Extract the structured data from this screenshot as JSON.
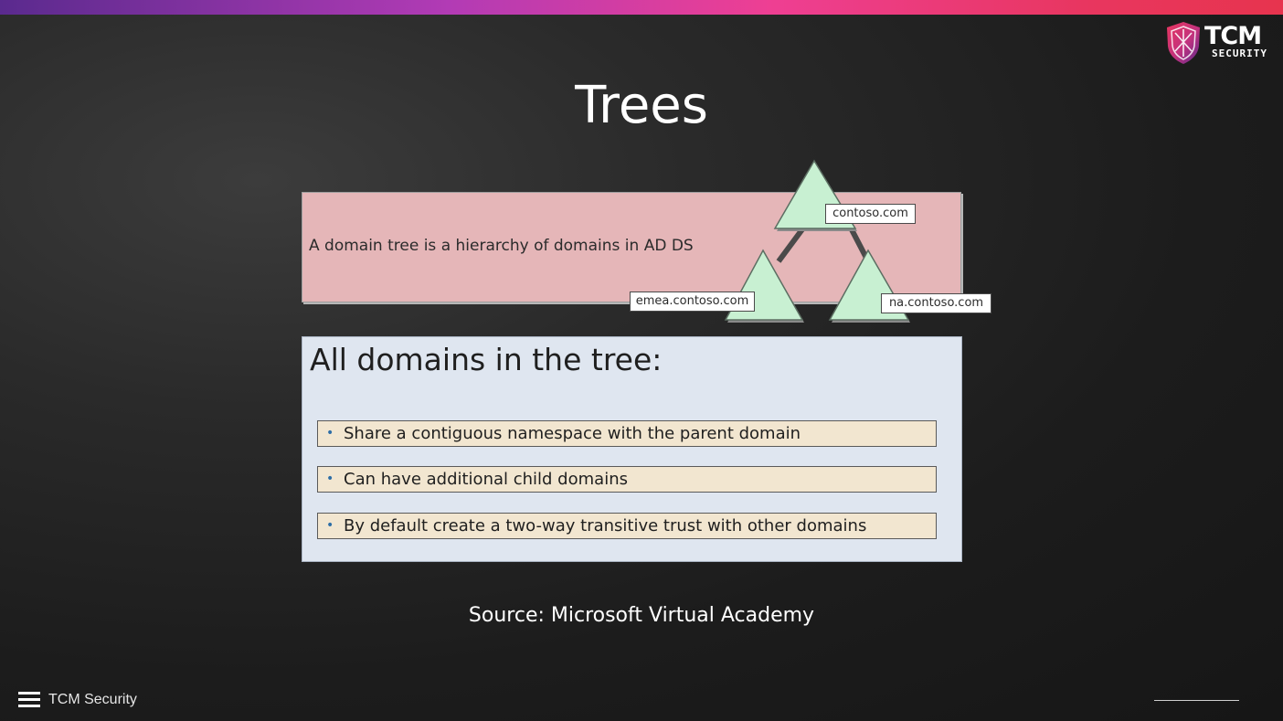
{
  "slide": {
    "title": "Trees",
    "definition": "A domain tree is a hierarchy of domains in AD DS",
    "list_heading": "All domains in the tree:",
    "bullets": [
      "Share a contiguous namespace with the parent domain",
      "Can have additional child domains",
      "By default create a two-way transitive trust with other domains"
    ],
    "bullet_marker": "•",
    "source": "Source: Microsoft Virtual Academy"
  },
  "diagram": {
    "root_domain": "contoso.com",
    "child_domains": [
      "emea.contoso.com",
      "na.contoso.com"
    ]
  },
  "branding": {
    "logo_main": "TCM",
    "logo_sub": "SECURITY",
    "footer_brand": "TCM Security"
  },
  "colors": {
    "top_bar_gradient": [
      "#5a2a8e",
      "#ee3f93",
      "#e7344e"
    ],
    "pink_panel": "#e5b6b8",
    "blue_panel": "#dfe6f0",
    "bullet_fill": "#f2e6d0",
    "triangle_fill": "#c8f0d2",
    "bullet_dot": "#2e6ea6"
  },
  "icons": [
    "tcm-shield-logo-icon",
    "hamburger-menu-icon"
  ]
}
